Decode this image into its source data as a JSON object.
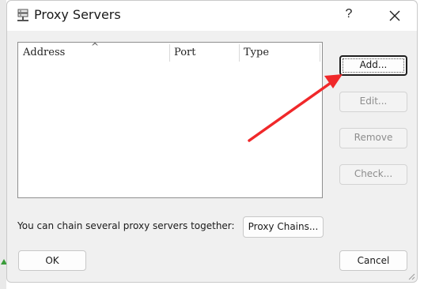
{
  "dialog": {
    "title": "Proxy Servers",
    "help_label": "?",
    "title_icon": "server-icon",
    "close_icon": "close-icon"
  },
  "list": {
    "columns": [
      "Address",
      "Port",
      "Type"
    ],
    "sort_indicator": "^",
    "rows": []
  },
  "buttons": {
    "add": "Add...",
    "edit": "Edit...",
    "remove": "Remove",
    "check": "Check...",
    "proxy_chains": "Proxy Chains...",
    "ok": "OK",
    "cancel": "Cancel"
  },
  "chain_text": "You can chain several proxy servers together:",
  "annotation": {
    "arrow_color": "#f0282a"
  },
  "colors": {
    "dialog_bg": "#f0f0f0",
    "list_bg": "#ffffff",
    "disabled_text": "#8d8d8d"
  }
}
